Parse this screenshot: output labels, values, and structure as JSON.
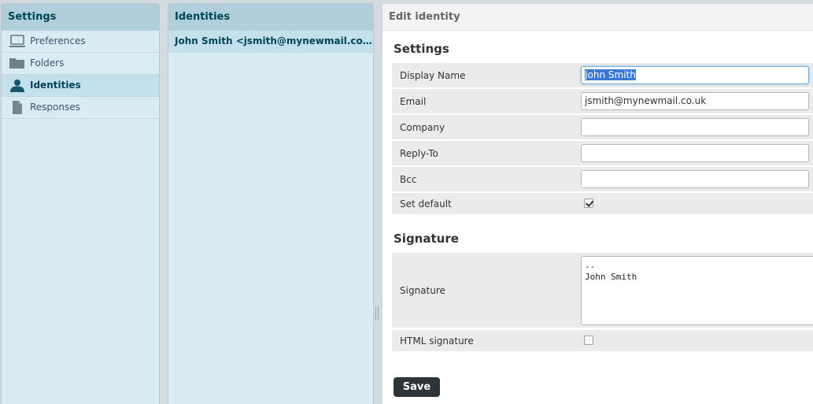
{
  "settings_panel": {
    "title": "Settings",
    "items": [
      {
        "label": "Preferences",
        "icon": "laptop-icon"
      },
      {
        "label": "Folders",
        "icon": "folder-icon"
      },
      {
        "label": "Identities",
        "icon": "user-icon",
        "selected": true
      },
      {
        "label": "Responses",
        "icon": "document-icon"
      }
    ]
  },
  "identities_panel": {
    "title": "Identities",
    "items": [
      {
        "label": "John Smith <jsmith@mynewmail.co...."
      }
    ]
  },
  "edit_panel": {
    "title": "Edit identity",
    "settings_section": {
      "title": "Settings",
      "display_name_label": "Display Name",
      "display_name_value": "John Smith",
      "email_label": "Email",
      "email_value": "jsmith@mynewmail.co.uk",
      "company_label": "Company",
      "company_value": "",
      "reply_to_label": "Reply-To",
      "reply_to_value": "",
      "bcc_label": "Bcc",
      "bcc_value": "",
      "set_default_label": "Set default",
      "set_default_checked": true
    },
    "signature_section": {
      "title": "Signature",
      "signature_label": "Signature",
      "signature_value": "--\nJohn Smith",
      "html_signature_label": "HTML signature",
      "html_signature_checked": false
    },
    "save_label": "Save"
  },
  "colors": {
    "panel_bg": "#d9ecf4",
    "panel_header": "#b0cfda",
    "accent_text": "#004458",
    "save_button": "#2d3538"
  }
}
